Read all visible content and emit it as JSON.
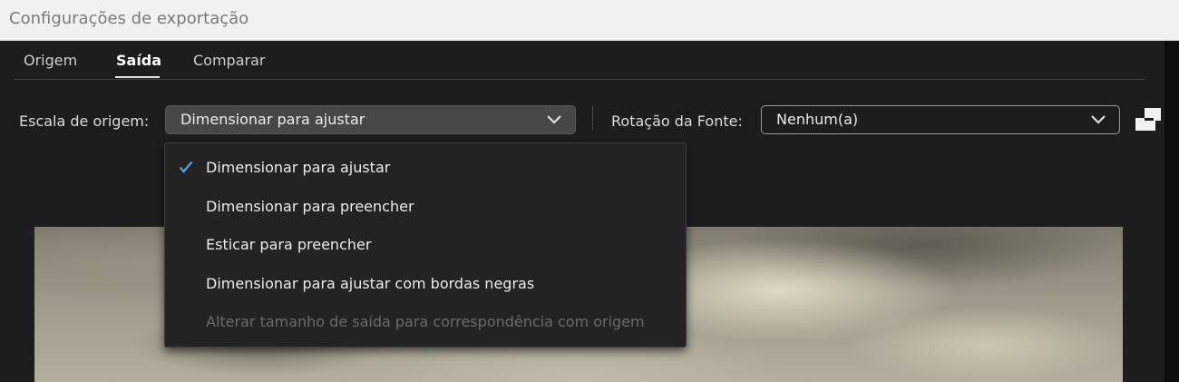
{
  "window": {
    "title": "Configurações de exportação"
  },
  "tabs": [
    {
      "label": "Origem",
      "active": false
    },
    {
      "label": "Saída",
      "active": true
    },
    {
      "label": "Comparar",
      "active": false
    }
  ],
  "source_scale": {
    "label": "Escala de origem:",
    "selected": "Dimensionar para ajustar",
    "options": [
      {
        "label": "Dimensionar para ajustar",
        "checked": true,
        "enabled": true
      },
      {
        "label": "Dimensionar para preencher",
        "checked": false,
        "enabled": true
      },
      {
        "label": "Esticar para preencher",
        "checked": false,
        "enabled": true
      },
      {
        "label": "Dimensionar para ajustar com bordas negras",
        "checked": false,
        "enabled": true
      },
      {
        "label": "Alterar tamanho de saída para correspondência com origem",
        "checked": false,
        "enabled": false
      }
    ]
  },
  "source_rotation": {
    "label": "Rotação da Fonte:",
    "selected": "Nenhum(a)"
  },
  "icons": {
    "dropdown": "chevron-down-icon",
    "checked": "checkmark-icon",
    "fit": "fit-frame-icon"
  },
  "colors": {
    "background": "#1d1d1d",
    "accent_check": "#4a9ff0",
    "disabled_text": "#6b6b6b"
  }
}
